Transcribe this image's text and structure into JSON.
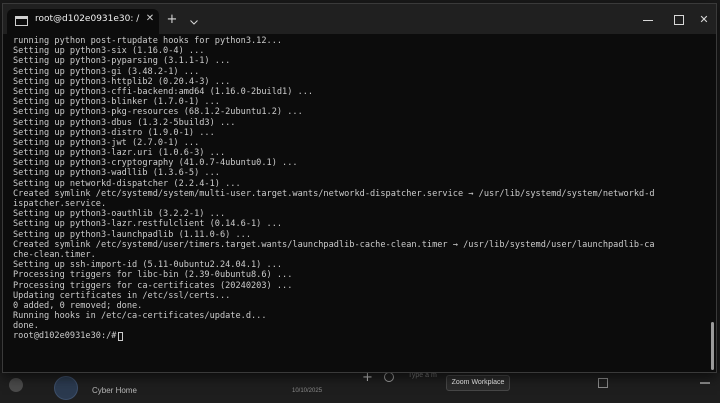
{
  "window": {
    "tab_title": "root@d102e0931e30: /",
    "new_tab_symbol": "+",
    "close_symbol": "✕"
  },
  "terminal": {
    "lines": [
      "running python post-rtupdate hooks for python3.12...",
      "Setting up python3-six (1.16.0-4) ...",
      "Setting up python3-pyparsing (3.1.1-1) ...",
      "Setting up python3-gi (3.48.2-1) ...",
      "Setting up python3-httplib2 (0.20.4-3) ...",
      "Setting up python3-cffi-backend:amd64 (1.16.0-2build1) ...",
      "Setting up python3-blinker (1.7.0-1) ...",
      "Setting up python3-pkg-resources (68.1.2-2ubuntu1.2) ...",
      "Setting up python3-dbus (1.3.2-5build3) ...",
      "Setting up python3-distro (1.9.0-1) ...",
      "Setting up python3-jwt (2.7.0-1) ...",
      "Setting up python3-lazr.uri (1.0.6-3) ...",
      "Setting up python3-cryptography (41.0.7-4ubuntu0.1) ...",
      "Setting up python3-wadllib (1.3.6-5) ...",
      "Setting up networkd-dispatcher (2.2.4-1) ...",
      "Created symlink /etc/systemd/system/multi-user.target.wants/networkd-dispatcher.service → /usr/lib/systemd/system/networkd-d",
      "ispatcher.service.",
      "Setting up python3-oauthlib (3.2.2-1) ...",
      "Setting up python3-lazr.restfulclient (0.14.6-1) ...",
      "Setting up python3-launchpadlib (1.11.0-6) ...",
      "Created symlink /etc/systemd/user/timers.target.wants/launchpadlib-cache-clean.timer → /usr/lib/systemd/user/launchpadlib-ca",
      "che-clean.timer.",
      "Setting up ssh-import-id (5.11-0ubuntu2.24.04.1) ...",
      "Processing triggers for libc-bin (2.39-0ubuntu8.6) ...",
      "Processing triggers for ca-certificates (20240203) ...",
      "Updating certificates in /etc/ssl/certs...",
      "0 added, 0 removed; done.",
      "Running hooks in /etc/ca-certificates/update.d...",
      "done."
    ],
    "prompt": "root@d102e0931e30:/#"
  },
  "background_app": {
    "chat_title": "Cyber Home",
    "chat_date": "10/10/2025",
    "message_placeholder": "Type a m",
    "add_symbol": "+"
  },
  "tooltip": {
    "text": "Zoom Workplace"
  },
  "colors": {
    "terminal_bg": "#0c0c0c",
    "terminal_text": "#cccccc",
    "titlebar_bg": "#202020"
  }
}
